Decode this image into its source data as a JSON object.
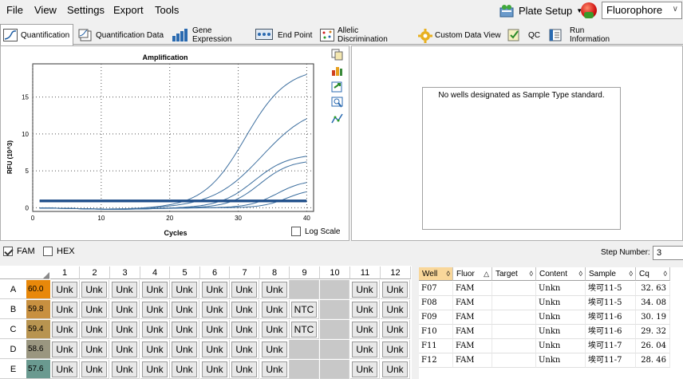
{
  "menu": {
    "file": "File",
    "view": "View",
    "settings": "Settings",
    "export": "Export",
    "tools": "Tools"
  },
  "toolbar": {
    "plate_setup": "Plate Setup",
    "fluorophore": "Fluorophore"
  },
  "tabs": [
    {
      "label": "Quantification",
      "icon": "quantification-icon"
    },
    {
      "label": "Quantification Data",
      "icon": "quant-data-icon"
    },
    {
      "label": "Gene Expression",
      "icon": "gene-expression-icon"
    },
    {
      "label": "End Point",
      "icon": "end-point-icon"
    },
    {
      "label": "Allelic Discrimination",
      "icon": "allelic-icon"
    },
    {
      "label": "Custom Data View",
      "icon": "custom-view-icon"
    },
    {
      "label": "QC",
      "icon": "qc-icon"
    },
    {
      "label": "Run Information",
      "icon": "run-info-icon"
    }
  ],
  "chart_data": {
    "type": "line",
    "title": "Amplification",
    "xlabel": "Cycles",
    "ylabel": "RFU (10^3)",
    "xlim": [
      0,
      41
    ],
    "ylim": [
      -0.5,
      19.5
    ],
    "xticks": [
      0,
      10,
      20,
      30,
      40
    ],
    "yticks": [
      0,
      5,
      10,
      15
    ],
    "grid": true,
    "series": [
      {
        "Cq": 26.04,
        "plateau": 19.0,
        "slope": 0.33
      },
      {
        "Cq": 28.46,
        "plateau": 14.0,
        "slope": 0.28
      },
      {
        "Cq": 29.32,
        "plateau": 7.3,
        "slope": 0.4
      },
      {
        "Cq": 30.19,
        "plateau": 6.5,
        "slope": 0.45
      },
      {
        "Cq": 32.63,
        "plateau": 3.8,
        "slope": 0.5
      },
      {
        "Cq": 34.08,
        "plateau": 2.6,
        "slope": 0.55
      },
      {
        "flat": 1.0
      },
      {
        "flat": 0.85
      }
    ]
  },
  "side_icons": [
    "copy-icon",
    "bar-chart-icon",
    "export-icon",
    "zoom-icon",
    "curve-icon"
  ],
  "log_scale": "Log Scale",
  "standard_msg": "No wells designated as Sample Type standard.",
  "filters": {
    "fam": "FAM",
    "hex": "HEX",
    "fam_checked": true,
    "hex_checked": false
  },
  "step": {
    "label": "Step Number:",
    "value": "3"
  },
  "plate": {
    "columns": [
      "1",
      "2",
      "3",
      "4",
      "5",
      "6",
      "7",
      "8",
      "9",
      "10",
      "11",
      "12"
    ],
    "rows": [
      {
        "label": "A",
        "temp": "60.0",
        "color": "#e8880a",
        "wells": [
          "Unk",
          "Unk",
          "Unk",
          "Unk",
          "Unk",
          "Unk",
          "Unk",
          "Unk",
          "",
          "",
          "Unk",
          "Unk"
        ]
      },
      {
        "label": "B",
        "temp": "59.8",
        "color": "#c89040",
        "wells": [
          "Unk",
          "Unk",
          "Unk",
          "Unk",
          "Unk",
          "Unk",
          "Unk",
          "Unk",
          "NTC",
          "",
          "Unk",
          "Unk"
        ]
      },
      {
        "label": "C",
        "temp": "59.4",
        "color": "#b89450",
        "wells": [
          "Unk",
          "Unk",
          "Unk",
          "Unk",
          "Unk",
          "Unk",
          "Unk",
          "Unk",
          "NTC",
          "",
          "Unk",
          "Unk"
        ]
      },
      {
        "label": "D",
        "temp": "58.6",
        "color": "#9a9680",
        "wells": [
          "Unk",
          "Unk",
          "Unk",
          "Unk",
          "Unk",
          "Unk",
          "Unk",
          "Unk",
          "",
          "",
          "Unk",
          "Unk"
        ]
      },
      {
        "label": "E",
        "temp": "57.6",
        "color": "#6a9a90",
        "wells": [
          "Unk",
          "Unk",
          "Unk",
          "Unk",
          "Unk",
          "Unk",
          "Unk",
          "Unk",
          "",
          "",
          "Unk",
          "Unk"
        ]
      }
    ]
  },
  "table": {
    "headers": [
      "Well",
      "Fluor",
      "Target",
      "Content",
      "Sample",
      "Cq"
    ],
    "rows": [
      [
        "F07",
        "FAM",
        "",
        "Unkn",
        "埃可11-5",
        "32. 63"
      ],
      [
        "F08",
        "FAM",
        "",
        "Unkn",
        "埃可11-5",
        "34. 08"
      ],
      [
        "F09",
        "FAM",
        "",
        "Unkn",
        "埃可11-6",
        "30. 19"
      ],
      [
        "F10",
        "FAM",
        "",
        "Unkn",
        "埃可11-6",
        "29. 32"
      ],
      [
        "F11",
        "FAM",
        "",
        "Unkn",
        "埃可11-7",
        "26. 04"
      ],
      [
        "F12",
        "FAM",
        "",
        "Unkn",
        "埃可11-7",
        "28. 46"
      ]
    ]
  }
}
